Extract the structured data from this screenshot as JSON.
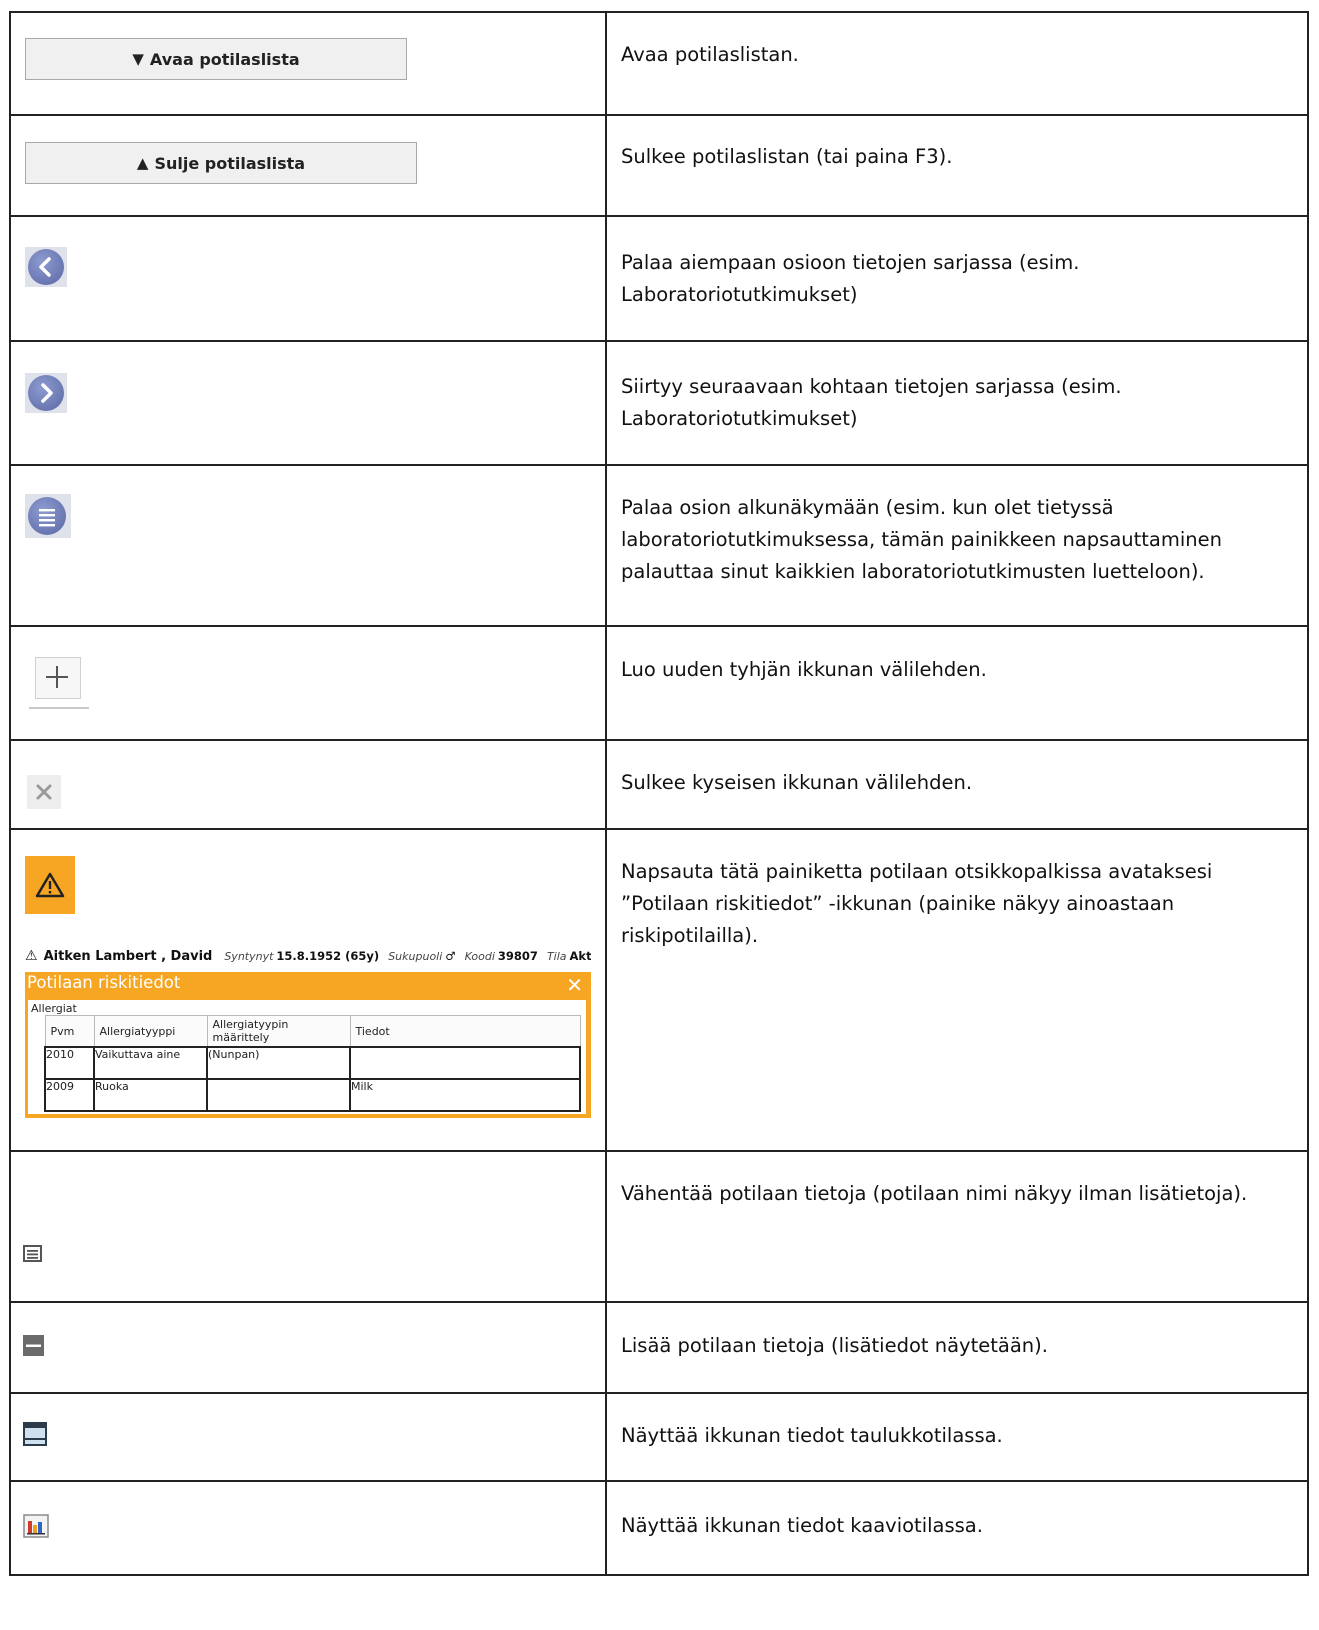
{
  "rows": [
    {
      "button_label": "Avaa potilaslista",
      "description": "Avaa potilaslistan."
    },
    {
      "button_label": "Sulje potilaslista",
      "description": "Sulkee potilaslistan (tai paina F3)."
    },
    {
      "icon": "chevron-left-circle-icon",
      "description": "Palaa aiempaan osioon tietojen sarjassa (esim. Laboratoriotutkimukset)"
    },
    {
      "icon": "chevron-right-circle-icon",
      "description": "Siirtyy seuraavaan kohtaan tietojen sarjassa (esim. Laboratoriotutkimukset)"
    },
    {
      "icon": "list-circle-icon",
      "description": "Palaa osion alkunäkymään (esim. kun olet tietyssä laboratoriotutkimuksessa, tämän painikkeen napsauttaminen palauttaa sinut kaikkien laboratoriotutkimusten luetteloon)."
    },
    {
      "icon": "plus-icon",
      "description": "Luo uuden tyhjän ikkunan välilehden."
    },
    {
      "icon": "close-icon",
      "description": "Sulkee kyseisen ikkunan välilehden."
    },
    {
      "icon": "warning-icon",
      "description": "Napsauta tätä painiketta potilaan otsikkopalkissa avataksesi ”Potilaan riskitiedot” -ikkunan (painike näkyy ainoastaan riskipotilailla)."
    },
    {
      "icon": "reduce-info-icon",
      "description": "Vähentää potilaan tietoja (potilaan nimi näkyy ilman lisätietoja)."
    },
    {
      "icon": "expand-info-icon",
      "description": "Lisää potilaan tietoja (lisätiedot näytetään)."
    },
    {
      "icon": "table-view-icon",
      "description": "Näyttää ikkunan tiedot taulukkotilassa."
    },
    {
      "icon": "chart-view-icon",
      "description": "Näyttää ikkunan tiedot kaaviotilassa."
    }
  ],
  "risk_popup": {
    "patient_name": "Aitken Lambert , David",
    "born_label": "Syntynyt",
    "born_value": "15.8.1952 (65y)",
    "sex_label": "Sukupuoli",
    "sex_symbol": "♂",
    "code_label": "Koodi",
    "code_value": "39807",
    "state_label": "Tila",
    "state_value": "Aktiivinen",
    "title": "Potilaan riskitiedot",
    "close": "✕",
    "section": "Allergiat",
    "columns": [
      "Pvm",
      "Allergiatyyppi",
      "Allergiatyypin määrittely",
      "Tiedot"
    ],
    "rows": [
      [
        "2010",
        "Vaikuttava aine",
        "(Nunpan)",
        ""
      ],
      [
        "2009",
        "Ruoka",
        "",
        "Milk"
      ]
    ],
    "accent": "#f6a623"
  }
}
